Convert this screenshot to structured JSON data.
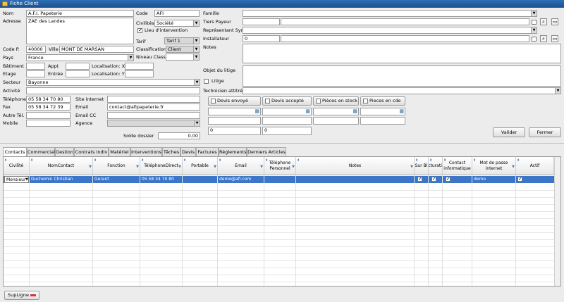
{
  "window": {
    "title": "Fiche Client"
  },
  "left": {
    "nom_label": "Nom",
    "nom": "A.F.I. Papeterie",
    "adresse_label": "Adresse",
    "adresse": "ZAE des Landes",
    "code_label": "Code",
    "code": "AFI",
    "civilites_label": "Civilités",
    "civilites": "Société",
    "lieu_label": "Lieu d'intervention",
    "tarif_label": "Tarif",
    "tarif": "Tarif 1",
    "classification_label": "Classification",
    "classification": "Client",
    "niveau_label": "Niveau Class.",
    "codep_label": "Code P.",
    "codep": "40000",
    "ville_label": "Ville",
    "ville": "MONT DE MARSAN",
    "pays_label": "Pays",
    "pays": "France",
    "batiment_label": "Bâtiment",
    "appt_label": "Appt",
    "locx_label": "Localisation: X",
    "etage_label": "Etage",
    "entree_label": "Entrée",
    "locy_label": "Localisation: Y",
    "secteur_label": "Secteur",
    "secteur": "Bayonne",
    "activite_label": "Activité",
    "telephone_label": "Téléphone",
    "telephone": "05 58 34 70 80",
    "site_label": "Site internet",
    "fax_label": "Fax",
    "fax": "05 58 34 72 39",
    "email_label": "Email",
    "email": "contact@afipapeterie.fr",
    "autretel_label": "Autre Tél.",
    "emailcc_label": "Email CC",
    "mobile_label": "Mobile",
    "agence_label": "Agence",
    "solde_label": "Solde dossier",
    "solde": "0.00"
  },
  "right": {
    "famille_label": "Famille",
    "tiers_label": "Tiers Payeur",
    "repr_label": "Représentant Synd",
    "install_label": "Installateur",
    "install": "0",
    "notes_label": "Notes",
    "objet_label": "Objet du litige",
    "litige_label": "Litige",
    "tech_label": "Technicien attitré",
    "devis_envoye": "Devis envoyé",
    "devis_accepte": "Devis accepté",
    "pieces_stock": "Pièces en stock",
    "pieces_cde": "Pieces en cde",
    "val0a": "0",
    "val0b": "0",
    "valider": "Valider",
    "fermer": "Fermer"
  },
  "tabs": [
    "Contacts",
    "Commercial",
    "Gestion",
    "Contrats Indiv",
    "Matériel",
    "Interventions",
    "Tâches",
    "Devis",
    "Factures",
    "Règlements",
    "Derniers Articles"
  ],
  "grid": {
    "headers": [
      "Civilité",
      "NomContact",
      "Fonction",
      "TéléphoneDirect",
      "Portable",
      "Email",
      "Téléphone Personnel",
      "Notes",
      "Sur Bl",
      "Facturation",
      "Contact informatique",
      "Mot de passe internet",
      "Actif"
    ],
    "row": {
      "civilite": "Monsieur",
      "nom": "Duchemin Christian",
      "fonction": "Gerant",
      "tel": "05 58 34 70 80",
      "email": "demo@afi.com",
      "mdp": "demo"
    }
  },
  "footer": {
    "supligne": "SupLigne"
  }
}
